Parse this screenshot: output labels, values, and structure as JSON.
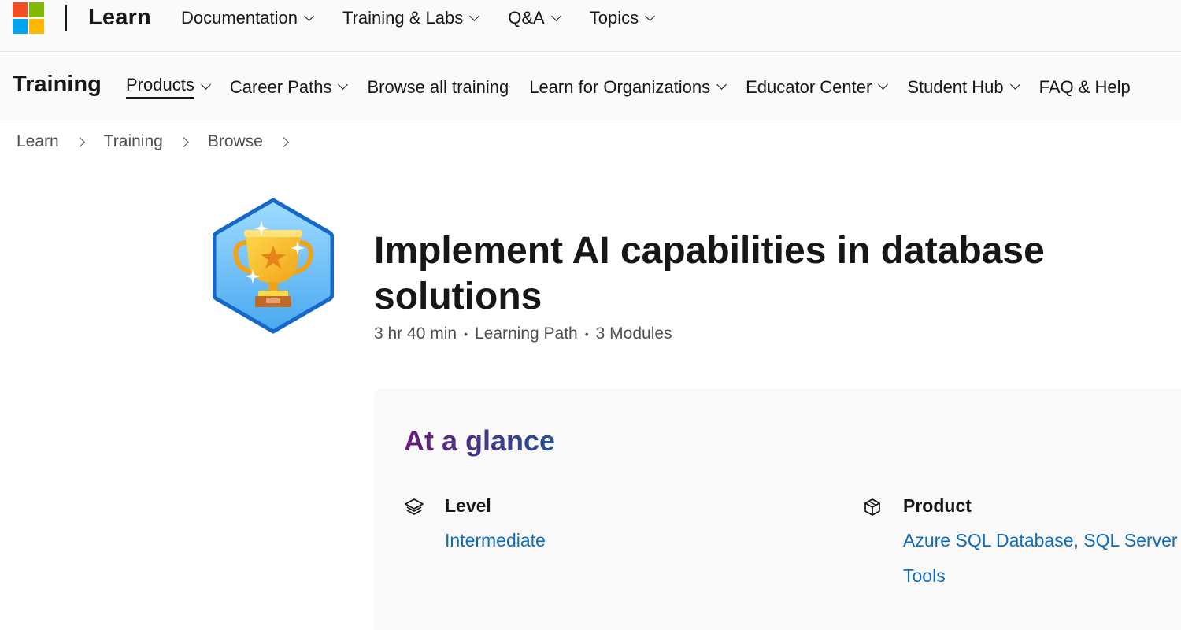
{
  "brand": {
    "name": "Learn",
    "logo_colors": [
      "#f25022",
      "#7fba00",
      "#00a4ef",
      "#ffb900"
    ]
  },
  "top_nav": {
    "items": [
      {
        "label": "Documentation"
      },
      {
        "label": "Training & Labs"
      },
      {
        "label": "Q&A"
      },
      {
        "label": "Topics"
      }
    ]
  },
  "sub_nav": {
    "title": "Training",
    "items": [
      {
        "label": "Products",
        "active": true
      },
      {
        "label": "Career Paths"
      },
      {
        "label": "Browse all training"
      },
      {
        "label": "Learn for Organizations"
      },
      {
        "label": "Educator Center"
      },
      {
        "label": "Student Hub"
      },
      {
        "label": "FAQ & Help"
      }
    ]
  },
  "breadcrumb": [
    "Learn",
    "Training",
    "Browse"
  ],
  "hero": {
    "badge_icon": "trophy-icon",
    "title": "Implement AI capabilities in database solutions",
    "duration": "3 hr 40 min",
    "type": "Learning Path",
    "modules": "3 Modules"
  },
  "glance": {
    "title": "At a glance",
    "level": {
      "label": "Level",
      "value": "Intermediate",
      "icon": "layers-icon"
    },
    "product": {
      "label": "Product",
      "value": "Azure SQL Database, SQL Server",
      "value2": "Tools",
      "icon": "box-icon"
    }
  },
  "colors": {
    "link": "#0f6cbd",
    "text": "#171717",
    "muted": "#505050",
    "badge_blue": "#1a74d8"
  }
}
